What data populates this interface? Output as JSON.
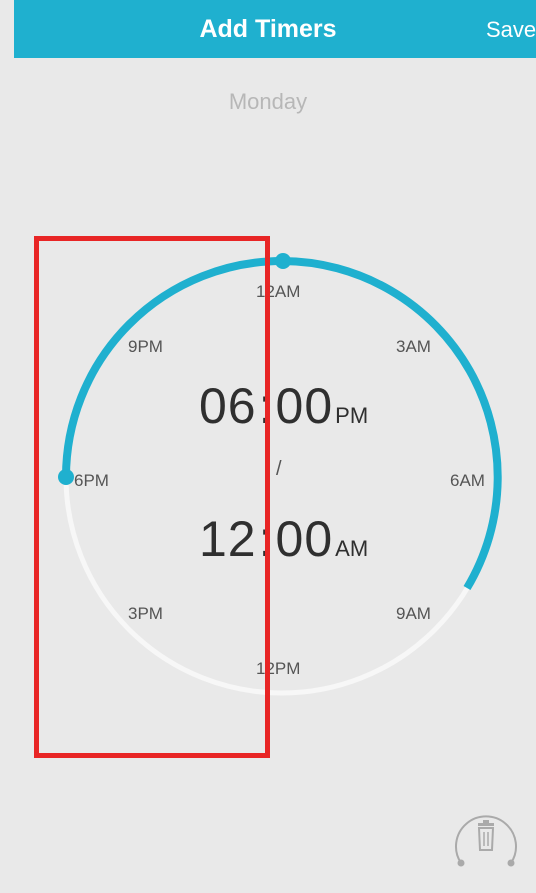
{
  "header": {
    "title": "Add Timers",
    "save_label": "Save"
  },
  "day_label": "Monday",
  "dial": {
    "hour_labels": {
      "top": "12AM",
      "top_right": "3AM",
      "right": "6AM",
      "bottom_right": "9AM",
      "bottom": "12PM",
      "bottom_left": "3PM",
      "left": "6PM",
      "top_left": "9PM"
    },
    "start_time": {
      "hours": "06",
      "minutes": "00",
      "ampm": "PM"
    },
    "separator": "/",
    "end_time": {
      "hours": "12",
      "minutes": "00",
      "ampm": "AM"
    },
    "colon": ":"
  },
  "colors": {
    "accent": "#1fb0cf",
    "track": "#f7f7f7",
    "background": "#e9e9e9",
    "highlight_box": "#e82525"
  },
  "icons": {
    "delete": "trash-icon"
  }
}
